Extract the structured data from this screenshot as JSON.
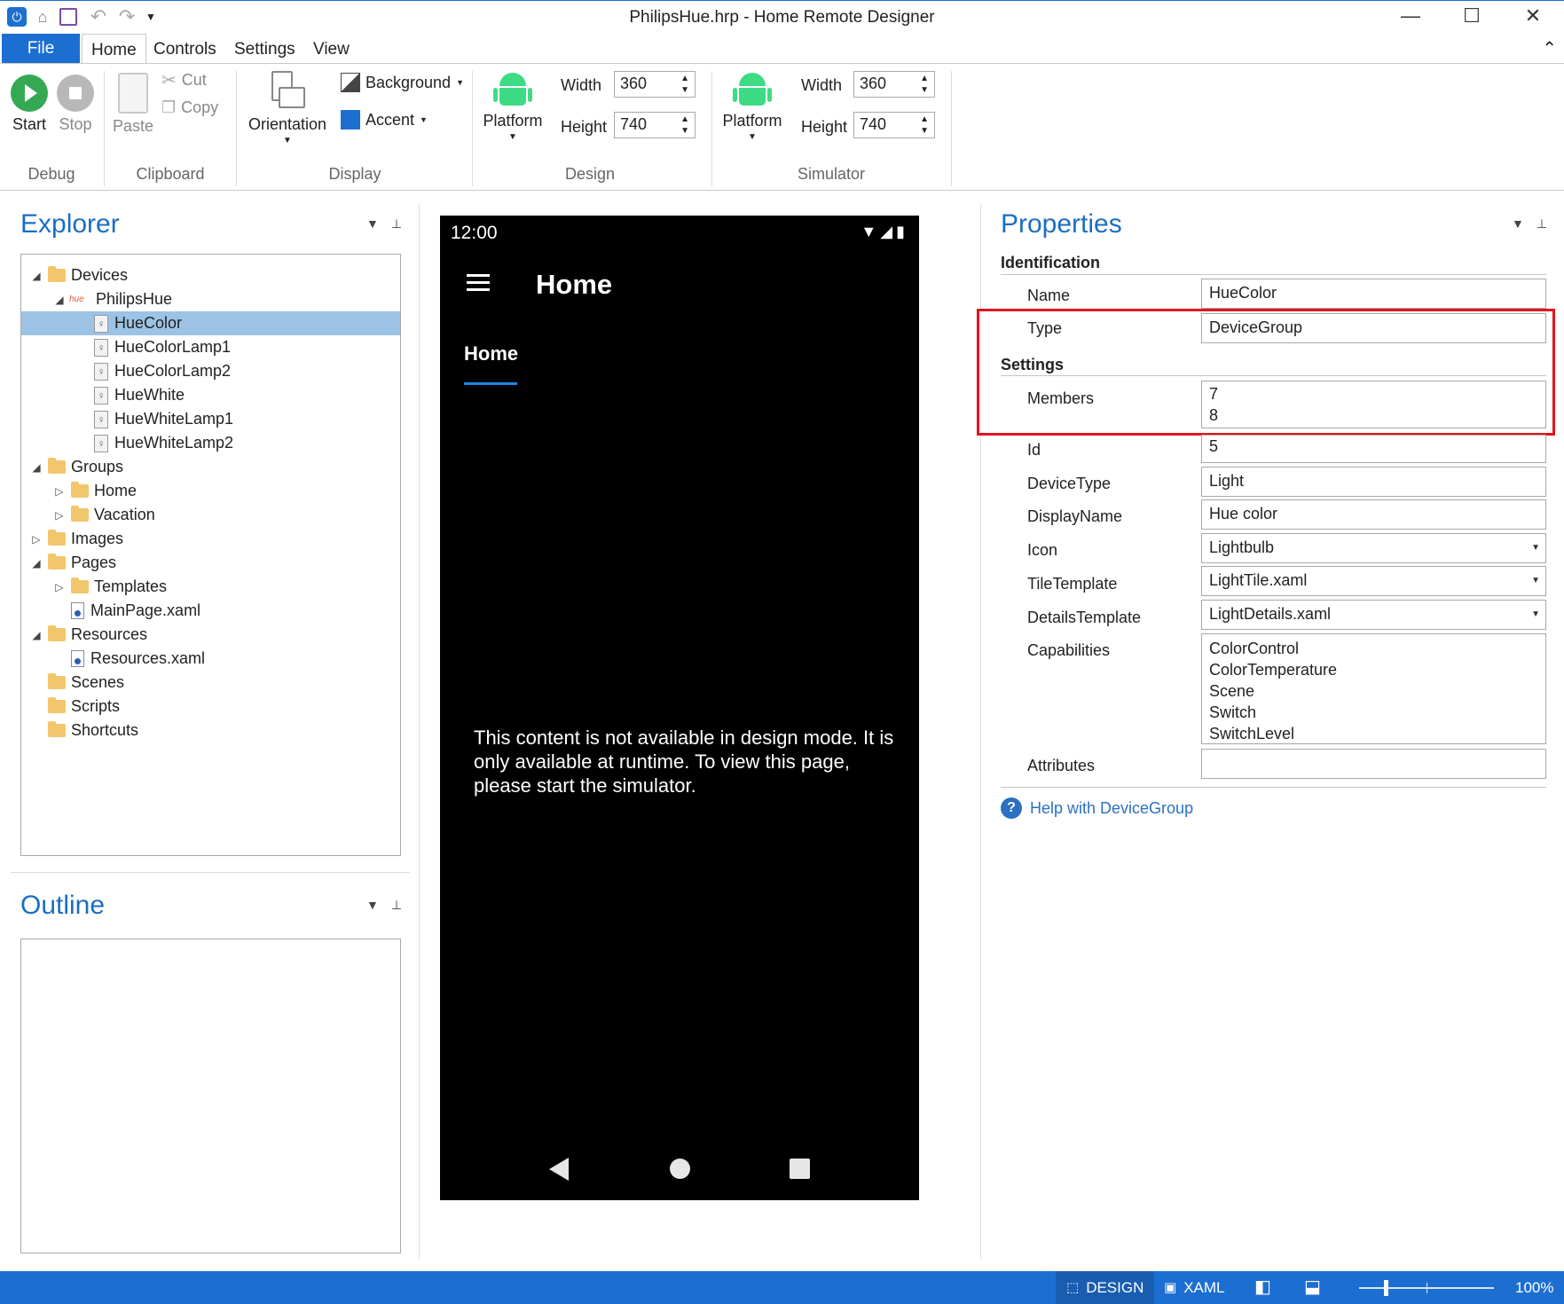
{
  "window": {
    "title": "PhilipsHue.hrp - Home Remote Designer",
    "minimize": "—",
    "maximize": "☐",
    "close": "✕"
  },
  "ribbon": {
    "file_tab": "File",
    "tabs": [
      "Home",
      "Controls",
      "Settings",
      "View"
    ],
    "groups": {
      "debug": {
        "label": "Debug",
        "start": "Start",
        "stop": "Stop"
      },
      "clipboard": {
        "label": "Clipboard",
        "paste": "Paste",
        "cut": "Cut",
        "copy": "Copy"
      },
      "display": {
        "label": "Display",
        "orientation": "Orientation",
        "background": "Background",
        "accent": "Accent"
      },
      "design": {
        "label": "Design",
        "platform": "Platform",
        "width_label": "Width",
        "width_value": "360",
        "height_label": "Height",
        "height_value": "740"
      },
      "simulator": {
        "label": "Simulator",
        "platform": "Platform",
        "width_label": "Width",
        "width_value": "360",
        "height_label": "Height",
        "height_value": "740"
      }
    }
  },
  "explorer": {
    "title": "Explorer",
    "tree": [
      {
        "label": "Devices",
        "icon": "folder-open-icon",
        "depth": 0,
        "toggle": "expanded"
      },
      {
        "label": "PhilipsHue",
        "icon": "hue-logo-icon",
        "depth": 1,
        "toggle": "expanded"
      },
      {
        "label": "HueColor",
        "icon": "lightbulb-icon",
        "depth": 2,
        "toggle": "none",
        "selected": true
      },
      {
        "label": "HueColorLamp1",
        "icon": "lightbulb-icon",
        "depth": 2,
        "toggle": "none"
      },
      {
        "label": "HueColorLamp2",
        "icon": "lightbulb-icon",
        "depth": 2,
        "toggle": "none"
      },
      {
        "label": "HueWhite",
        "icon": "lightbulb-icon",
        "depth": 2,
        "toggle": "none"
      },
      {
        "label": "HueWhiteLamp1",
        "icon": "lightbulb-icon",
        "depth": 2,
        "toggle": "none"
      },
      {
        "label": "HueWhiteLamp2",
        "icon": "lightbulb-icon",
        "depth": 2,
        "toggle": "none"
      },
      {
        "label": "Groups",
        "icon": "folder-open-icon",
        "depth": 0,
        "toggle": "expanded"
      },
      {
        "label": "Home",
        "icon": "folder-icon",
        "depth": 1,
        "toggle": "collapsed"
      },
      {
        "label": "Vacation",
        "icon": "folder-icon",
        "depth": 1,
        "toggle": "collapsed"
      },
      {
        "label": "Images",
        "icon": "folder-icon",
        "depth": 0,
        "toggle": "collapsed"
      },
      {
        "label": "Pages",
        "icon": "folder-open-icon",
        "depth": 0,
        "toggle": "expanded"
      },
      {
        "label": "Templates",
        "icon": "folder-icon",
        "depth": 1,
        "toggle": "collapsed"
      },
      {
        "label": "MainPage.xaml",
        "icon": "xaml-file-icon",
        "depth": 1,
        "toggle": "none"
      },
      {
        "label": "Resources",
        "icon": "folder-open-icon",
        "depth": 0,
        "toggle": "expanded"
      },
      {
        "label": "Resources.xaml",
        "icon": "xaml-file-icon",
        "depth": 1,
        "toggle": "none"
      },
      {
        "label": "Scenes",
        "icon": "folder-icon",
        "depth": 0,
        "toggle": "none"
      },
      {
        "label": "Scripts",
        "icon": "folder-icon",
        "depth": 0,
        "toggle": "none"
      },
      {
        "label": "Shortcuts",
        "icon": "folder-icon",
        "depth": 0,
        "toggle": "none"
      }
    ]
  },
  "outline": {
    "title": "Outline"
  },
  "preview": {
    "time": "12:00",
    "page_title": "Home",
    "tab": "Home",
    "message": "This content is not available in design mode. It is only available at runtime. To view this page, please start the simulator."
  },
  "properties": {
    "title": "Properties",
    "sections": {
      "identification": "Identification",
      "settings": "Settings"
    },
    "name": {
      "label": "Name",
      "value": "HueColor"
    },
    "type": {
      "label": "Type",
      "value": "DeviceGroup"
    },
    "members": {
      "label": "Members",
      "values": [
        "7",
        "8"
      ]
    },
    "id": {
      "label": "Id",
      "value": "5"
    },
    "device_type": {
      "label": "DeviceType",
      "value": "Light"
    },
    "display_name": {
      "label": "DisplayName",
      "value": "Hue color"
    },
    "icon": {
      "label": "Icon",
      "value": "Lightbulb"
    },
    "tile_template": {
      "label": "TileTemplate",
      "value": "LightTile.xaml"
    },
    "details_template": {
      "label": "DetailsTemplate",
      "value": "LightDetails.xaml"
    },
    "capabilities": {
      "label": "Capabilities",
      "values": [
        "ColorControl",
        "ColorTemperature",
        "Scene",
        "Switch",
        "SwitchLevel"
      ]
    },
    "attributes": {
      "label": "Attributes",
      "value": ""
    },
    "help": "Help with DeviceGroup"
  },
  "statusbar": {
    "design": "DESIGN",
    "xaml": "XAML",
    "zoom": "100%",
    "zoom_fraction": 0.2
  },
  "colors": {
    "accent": "#1c6fd1",
    "highlight": "#e0141e",
    "selection": "#9cc3e5",
    "android_green": "#3ddc84"
  }
}
